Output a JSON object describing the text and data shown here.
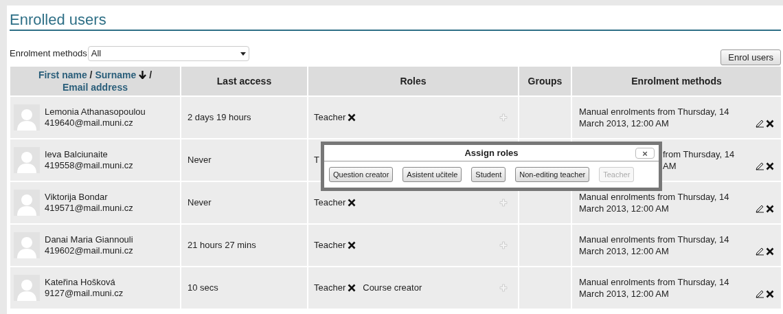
{
  "title": "Enrolled users",
  "filter": {
    "label": "Enrolment methods",
    "value": "All"
  },
  "enrol_button": "Enrol users",
  "columns": [
    {
      "kind": "links",
      "links": [
        {
          "label": "First name",
          "sorted": false
        },
        {
          "label": "Surname",
          "sorted": true
        },
        {
          "label": "Email address",
          "sorted": false
        }
      ],
      "separator": "/"
    },
    {
      "kind": "text",
      "label": "Last access"
    },
    {
      "kind": "text",
      "label": "Roles"
    },
    {
      "kind": "text",
      "label": "Groups"
    },
    {
      "kind": "text",
      "label": "Enrolment methods"
    }
  ],
  "rows": [
    {
      "name": "Lemonia Athanasopoulou",
      "email": "419640@mail.muni.cz",
      "last_access": "2 days 19 hours",
      "roles": [
        {
          "label": "Teacher",
          "removable": true
        }
      ],
      "covered": false,
      "enrolment": [
        "Manual enrolments from Thursday, 14",
        "March 2013, 12:00 AM"
      ]
    },
    {
      "name": "Ieva Balciunaite",
      "email": "419558@mail.muni.cz",
      "last_access": "Never",
      "roles": [
        {
          "label": "T",
          "removable": false
        }
      ],
      "covered": true,
      "enrolment": [
        "from Thursday, 14",
        "AM"
      ]
    },
    {
      "name": "Viktorija Bondar",
      "email": "419571@mail.muni.cz",
      "last_access": "Never",
      "roles": [
        {
          "label": "Teacher",
          "removable": true
        }
      ],
      "covered": false,
      "enrolment": [
        "Manual enrolments from Thursday, 14",
        "March 2013, 12:00 AM"
      ]
    },
    {
      "name": "Danai Maria Giannouli",
      "email": "419602@mail.muni.cz",
      "last_access": "21 hours 27 mins",
      "roles": [
        {
          "label": "Teacher",
          "removable": true
        }
      ],
      "covered": false,
      "enrolment": [
        "Manual enrolments from Thursday, 14",
        "March 2013, 12:00 AM"
      ]
    },
    {
      "name": "Kateřina Hošková",
      "email": "9127@mail.muni.cz",
      "last_access": "10 secs",
      "roles": [
        {
          "label": "Teacher",
          "removable": true
        },
        {
          "label": "Course creator",
          "removable": false
        }
      ],
      "covered": false,
      "enrolment": [
        "Manual enrolments from Thursday, 14",
        "March 2013, 12:00 AM"
      ]
    }
  ],
  "popup": {
    "title": "Assign roles",
    "close": "×",
    "roles": [
      {
        "label": "Question creator",
        "disabled": false
      },
      {
        "label": "Asistent učitele",
        "disabled": false
      },
      {
        "label": "Student",
        "disabled": false
      },
      {
        "label": "Non-editing teacher",
        "disabled": false
      },
      {
        "label": "Teacher",
        "disabled": true
      }
    ]
  }
}
